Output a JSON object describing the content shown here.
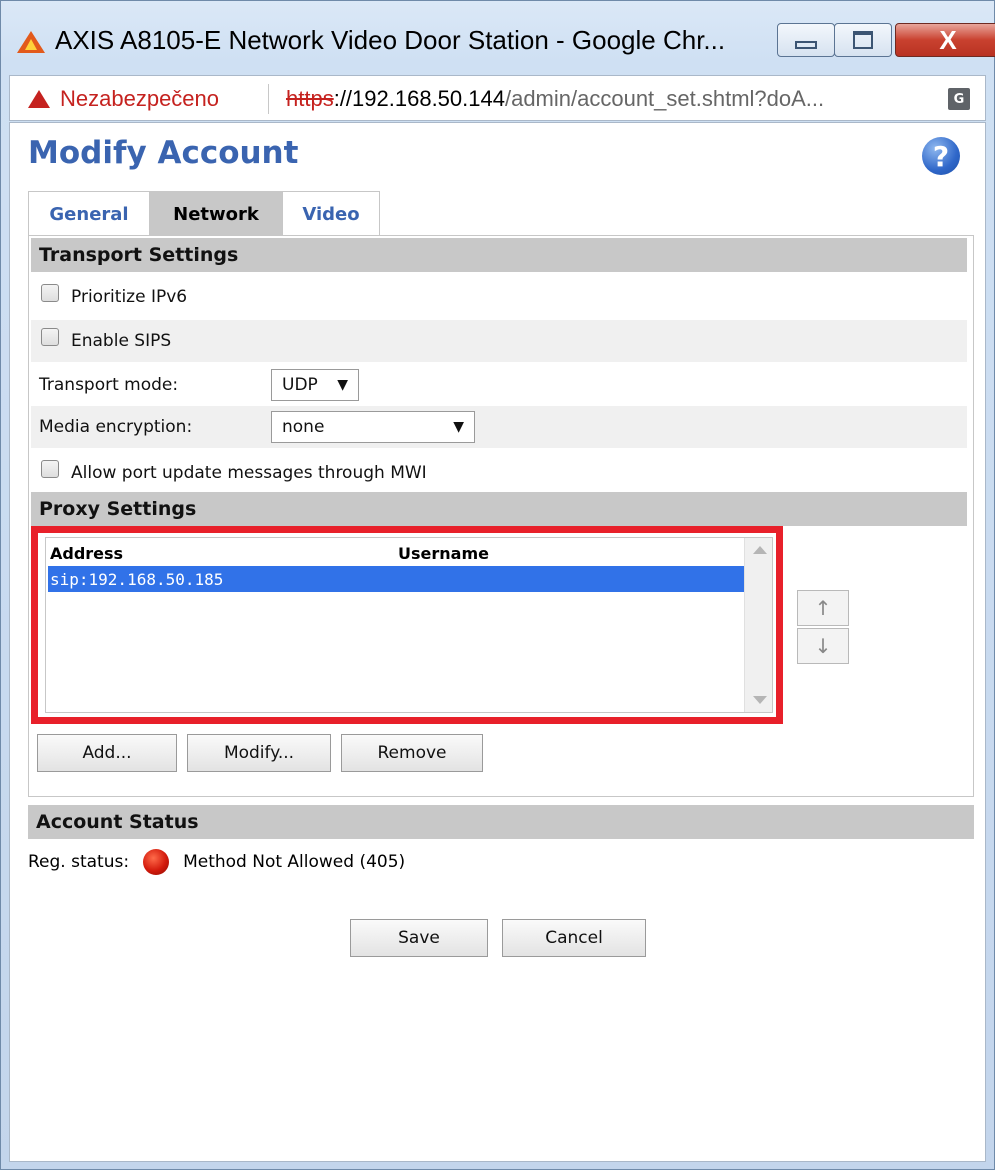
{
  "window": {
    "title": "AXIS A8105-E Network Video Door Station - Google Chr...",
    "close_label": "X"
  },
  "address_bar": {
    "security_label": "Nezabezpečeno",
    "url_scheme": "https",
    "url_host": "://192.168.50.144",
    "url_path": "/admin/account_set.shtml?doA...",
    "translate_label": "G"
  },
  "page": {
    "title": "Modify Account",
    "help_label": "?",
    "tabs": [
      {
        "label": "General"
      },
      {
        "label": "Network"
      },
      {
        "label": "Video"
      }
    ],
    "active_tab": "Network"
  },
  "transport": {
    "header": "Transport Settings",
    "prioritize_ipv6": {
      "label": "Prioritize IPv6",
      "checked": false
    },
    "enable_sips": {
      "label": "Enable SIPS",
      "checked": false
    },
    "transport_mode": {
      "label": "Transport mode:",
      "value": "UDP"
    },
    "media_encryption": {
      "label": "Media encryption:",
      "value": "none"
    },
    "allow_port_update": {
      "label": "Allow port update messages through MWI",
      "checked": false
    }
  },
  "proxy": {
    "header": "Proxy Settings",
    "columns": [
      "Address",
      "Username"
    ],
    "rows": [
      {
        "address": "sip:192.168.50.185",
        "username": ""
      }
    ],
    "move_up_label": "↑",
    "move_down_label": "↓",
    "add_label": "Add...",
    "modify_label": "Modify...",
    "remove_label": "Remove"
  },
  "account_status": {
    "header": "Account Status",
    "label": "Reg. status:",
    "value": "Method Not Allowed (405)"
  },
  "actions": {
    "save_label": "Save",
    "cancel_label": "Cancel"
  },
  "colors": {
    "title_blue": "#3a64b0",
    "highlight_red": "#e8202a",
    "selection_blue": "#3172e8",
    "status_red": "#d31a0c"
  }
}
